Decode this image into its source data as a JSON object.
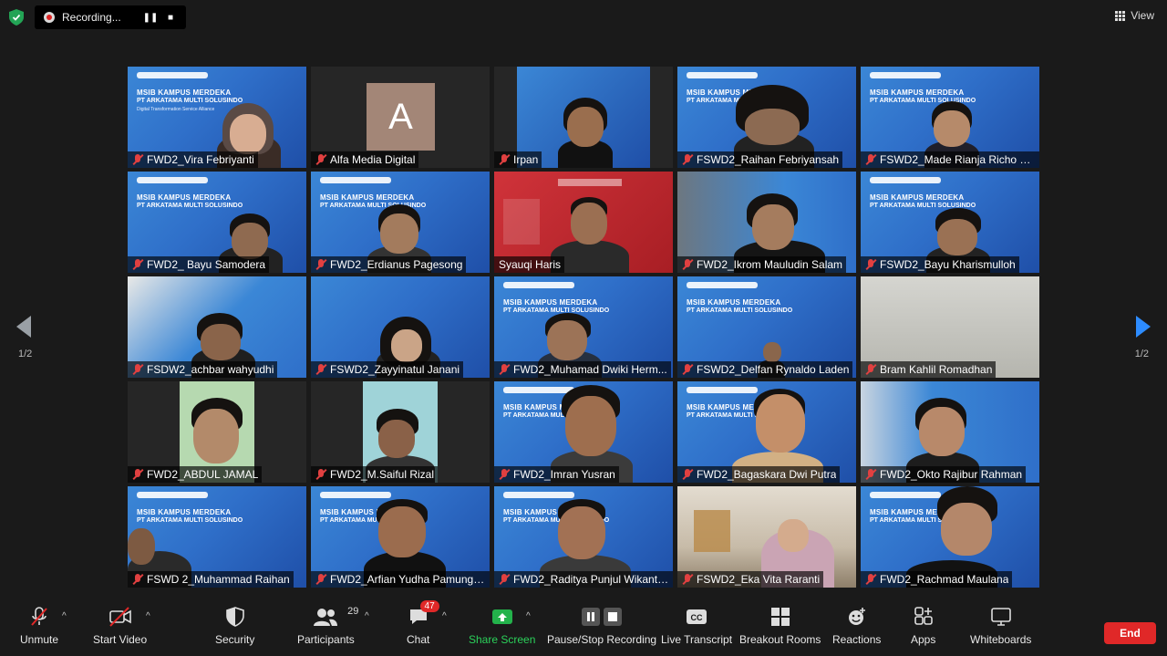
{
  "recording": {
    "label": "Recording..."
  },
  "view": {
    "label": "View"
  },
  "pagination": {
    "left": "1/2",
    "right": "1/2"
  },
  "slide": {
    "line1": "MSIB KAMPUS MERDEKA",
    "line2": "PT ARKATAMA MULTI SOLUSINDO",
    "line3": "Digital Transformation Service Alliance"
  },
  "avatar": {
    "letter": "A"
  },
  "participants": [
    {
      "name": "FWD2_Vira Febriyanti"
    },
    {
      "name": "Alfa Media Digital"
    },
    {
      "name": "Irpan"
    },
    {
      "name": "FSWD2_Raihan Febriyansah"
    },
    {
      "name": "FSWD2_Made Rianja Richo D..."
    },
    {
      "name": "FWD2_ Bayu Samodera"
    },
    {
      "name": "FWD2_Erdianus Pagesong"
    },
    {
      "name": "Syauqi Haris"
    },
    {
      "name": "FWD2_Ikrom Mauludin Salam"
    },
    {
      "name": "FSWD2_Bayu Kharismulloh"
    },
    {
      "name": "FSDW2_achbar wahyudhi"
    },
    {
      "name": "FSWD2_Zayyinatul Janani"
    },
    {
      "name": "FWD2_Muhamad Dwiki Herm..."
    },
    {
      "name": "FSWD2_Delfan Rynaldo Laden"
    },
    {
      "name": "Bram Kahlil Romadhan"
    },
    {
      "name": "FWD2_ABDUL JAMAL"
    },
    {
      "name": "FWD2_M.Saiful Rizal"
    },
    {
      "name": "FWD2_Imran Yusran"
    },
    {
      "name": "FWD2_Bagaskara Dwi Putra"
    },
    {
      "name": "FWD2_Okto Rajibur Rahman"
    },
    {
      "name": "FSWD 2_Muhammad Raihan"
    },
    {
      "name": "FWD2_Arfian Yudha Pamungkas"
    },
    {
      "name": "FWD2_Raditya Punjul Wikanto..."
    },
    {
      "name": "FSWD2_Eka Vita Raranti"
    },
    {
      "name": "FWD2_Rachmad Maulana"
    }
  ],
  "toolbar": {
    "unmute": "Unmute",
    "start_video": "Start Video",
    "security": "Security",
    "participants": "Participants",
    "participants_count": "29",
    "chat": "Chat",
    "chat_badge": "47",
    "share_screen": "Share Screen",
    "pause_stop": "Pause/Stop Recording",
    "live_transcript": "Live Transcript",
    "breakout": "Breakout Rooms",
    "reactions": "Reactions",
    "apps": "Apps",
    "whiteboards": "Whiteboards",
    "end": "End"
  }
}
